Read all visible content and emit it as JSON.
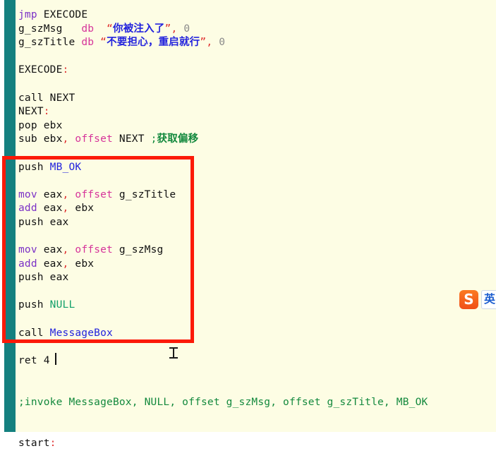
{
  "window": {
    "background_color": "#fdfde4",
    "margin_bar_color": "#14807f",
    "annotation_color": "#fc1a08"
  },
  "editor": {
    "language": "x86 assembly",
    "lines": [
      {
        "id": "line-jmp",
        "segments": [
          {
            "t": "jmp ",
            "c": "kw"
          },
          {
            "t": "EXECODE",
            "c": "plain"
          }
        ]
      },
      {
        "id": "line-g-szmsg",
        "segments": [
          {
            "t": "g_szMsg",
            "c": "plain"
          },
          {
            "t": "   ",
            "c": "plain"
          },
          {
            "t": "db",
            "c": "db"
          },
          {
            "t": "  ",
            "c": "plain"
          },
          {
            "t": "“",
            "c": "quote"
          },
          {
            "t": "你被注入了",
            "c": "str-cn"
          },
          {
            "t": "”",
            "c": "quote"
          },
          {
            "t": ", ",
            "c": "punc"
          },
          {
            "t": "0",
            "c": "num"
          }
        ]
      },
      {
        "id": "line-g-sztitle",
        "segments": [
          {
            "t": "g_szTitle",
            "c": "plain"
          },
          {
            "t": " ",
            "c": "plain"
          },
          {
            "t": "db",
            "c": "db"
          },
          {
            "t": " ",
            "c": "plain"
          },
          {
            "t": "“",
            "c": "quote"
          },
          {
            "t": "不要担心，重启就行",
            "c": "str-cn"
          },
          {
            "t": "”",
            "c": "quote"
          },
          {
            "t": ", ",
            "c": "punc"
          },
          {
            "t": "0",
            "c": "num"
          }
        ]
      },
      {
        "id": "line-blank-1",
        "segments": []
      },
      {
        "id": "line-execode",
        "segments": [
          {
            "t": "EXECODE",
            "c": "plain"
          },
          {
            "t": ":",
            "c": "punc"
          }
        ]
      },
      {
        "id": "line-blank-2",
        "segments": []
      },
      {
        "id": "line-call-next",
        "segments": [
          {
            "t": "call NEXT",
            "c": "plain"
          }
        ]
      },
      {
        "id": "line-next-label",
        "segments": [
          {
            "t": "NEXT",
            "c": "plain"
          },
          {
            "t": ":",
            "c": "punc"
          }
        ]
      },
      {
        "id": "line-pop-ebx",
        "segments": [
          {
            "t": "pop ebx",
            "c": "plain"
          }
        ]
      },
      {
        "id": "line-sub-ebx",
        "segments": [
          {
            "t": "sub ebx",
            "c": "plain"
          },
          {
            "t": ", ",
            "c": "punc"
          },
          {
            "t": "offset",
            "c": "off"
          },
          {
            "t": " NEXT ",
            "c": "plain"
          },
          {
            "t": ";",
            "c": "comment"
          },
          {
            "t": "获取偏移",
            "c": "comment-cn"
          }
        ]
      },
      {
        "id": "line-blank-3",
        "segments": []
      },
      {
        "id": "line-push-mbok",
        "segments": [
          {
            "t": "push ",
            "c": "plain"
          },
          {
            "t": "MB_OK",
            "c": "const"
          }
        ]
      },
      {
        "id": "line-blank-4",
        "segments": []
      },
      {
        "id": "line-mov-title",
        "segments": [
          {
            "t": "mov",
            "c": "kw"
          },
          {
            "t": " eax",
            "c": "plain"
          },
          {
            "t": ", ",
            "c": "punc"
          },
          {
            "t": "offset",
            "c": "off"
          },
          {
            "t": " g_szTitle",
            "c": "plain"
          }
        ]
      },
      {
        "id": "line-add-title",
        "segments": [
          {
            "t": "add",
            "c": "kw"
          },
          {
            "t": " eax",
            "c": "plain"
          },
          {
            "t": ", ",
            "c": "punc"
          },
          {
            "t": "ebx",
            "c": "plain"
          }
        ]
      },
      {
        "id": "line-push-eax-1",
        "segments": [
          {
            "t": "push eax",
            "c": "plain"
          }
        ]
      },
      {
        "id": "line-blank-5",
        "segments": []
      },
      {
        "id": "line-mov-msg",
        "segments": [
          {
            "t": "mov",
            "c": "kw"
          },
          {
            "t": " eax",
            "c": "plain"
          },
          {
            "t": ", ",
            "c": "punc"
          },
          {
            "t": "offset",
            "c": "off"
          },
          {
            "t": " g_szMsg",
            "c": "plain"
          }
        ]
      },
      {
        "id": "line-add-msg",
        "segments": [
          {
            "t": "add",
            "c": "kw"
          },
          {
            "t": " eax",
            "c": "plain"
          },
          {
            "t": ", ",
            "c": "punc"
          },
          {
            "t": "ebx",
            "c": "plain"
          }
        ]
      },
      {
        "id": "line-push-eax-2",
        "segments": [
          {
            "t": "push eax",
            "c": "plain"
          }
        ]
      },
      {
        "id": "line-blank-6",
        "segments": []
      },
      {
        "id": "line-push-null",
        "segments": [
          {
            "t": "push ",
            "c": "plain"
          },
          {
            "t": "NULL",
            "c": "null"
          }
        ]
      },
      {
        "id": "line-blank-7",
        "segments": []
      },
      {
        "id": "line-call-mbox",
        "segments": [
          {
            "t": "call ",
            "c": "plain"
          },
          {
            "t": "MessageBox",
            "c": "const"
          }
        ]
      },
      {
        "id": "line-blank-8",
        "segments": []
      },
      {
        "id": "line-ret-4",
        "segments": [
          {
            "t": "ret 4",
            "c": "plain"
          }
        ]
      },
      {
        "id": "line-blank-9",
        "segments": []
      },
      {
        "id": "line-blank-10",
        "segments": []
      },
      {
        "id": "line-invoke-cmt",
        "segments": [
          {
            "t": ";invoke MessageBox, NULL, offset g_szMsg, offset g_szTitle, MB_OK",
            "c": "comment"
          }
        ]
      },
      {
        "id": "line-blank-11",
        "segments": []
      },
      {
        "id": "line-blank-12",
        "segments": []
      },
      {
        "id": "line-start",
        "segments": [
          {
            "t": "start",
            "c": "plain"
          },
          {
            "t": ":",
            "c": "punc"
          }
        ]
      }
    ]
  },
  "annotation": {
    "label": "red-highlight-rectangle",
    "covers_lines": "push MB_OK .. call MessageBox"
  },
  "caret": {
    "after_text": "ret 4"
  },
  "pointer": {
    "icon": "i-beam-text-cursor"
  },
  "ime": {
    "logo_letter": "S",
    "mode_label": "英",
    "brand": "sogou-input-method"
  }
}
